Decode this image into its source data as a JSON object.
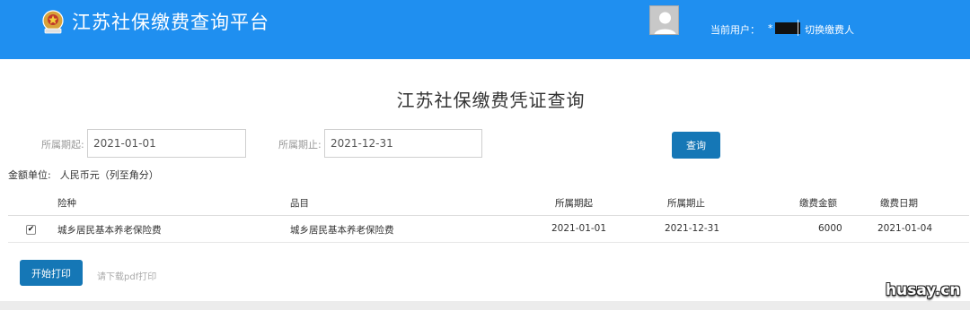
{
  "header": {
    "app_title": "江苏社保缴费查询平台",
    "user_label": "当前用户：",
    "user_prefix": "*",
    "switch_link": "切换缴费人"
  },
  "main": {
    "page_title": "江苏社保缴费凭证查询",
    "start_label": "所属期起:",
    "start_value": "2021-01-01",
    "end_label": "所属期止:",
    "end_value": "2021-12-31",
    "query_button": "查询",
    "unit_label": "金额单位:",
    "unit_value": "人民币元（列至角分）"
  },
  "table": {
    "headers": [
      "险种",
      "品目",
      "所属期起",
      "所属期止",
      "缴费金额",
      "缴费日期"
    ],
    "rows": [
      {
        "checked": true,
        "check_mark": "✔",
        "type": "城乡居民基本养老保险费",
        "item": "城乡居民基本养老保险费",
        "start": "2021-01-01",
        "end": "2021-12-31",
        "amount": "6000",
        "date": "2021-01-04"
      }
    ]
  },
  "footer": {
    "print_button": "开始打印",
    "pdf_hint": "请下载pdf打印"
  },
  "watermark": "husay.cn",
  "colors": {
    "header_bg": "#1f8ff0",
    "button_bg": "#1577b6"
  },
  "icons": {
    "logo": "tax-emblem-icon",
    "avatar": "user-avatar-icon",
    "checkbox": "check-icon"
  }
}
